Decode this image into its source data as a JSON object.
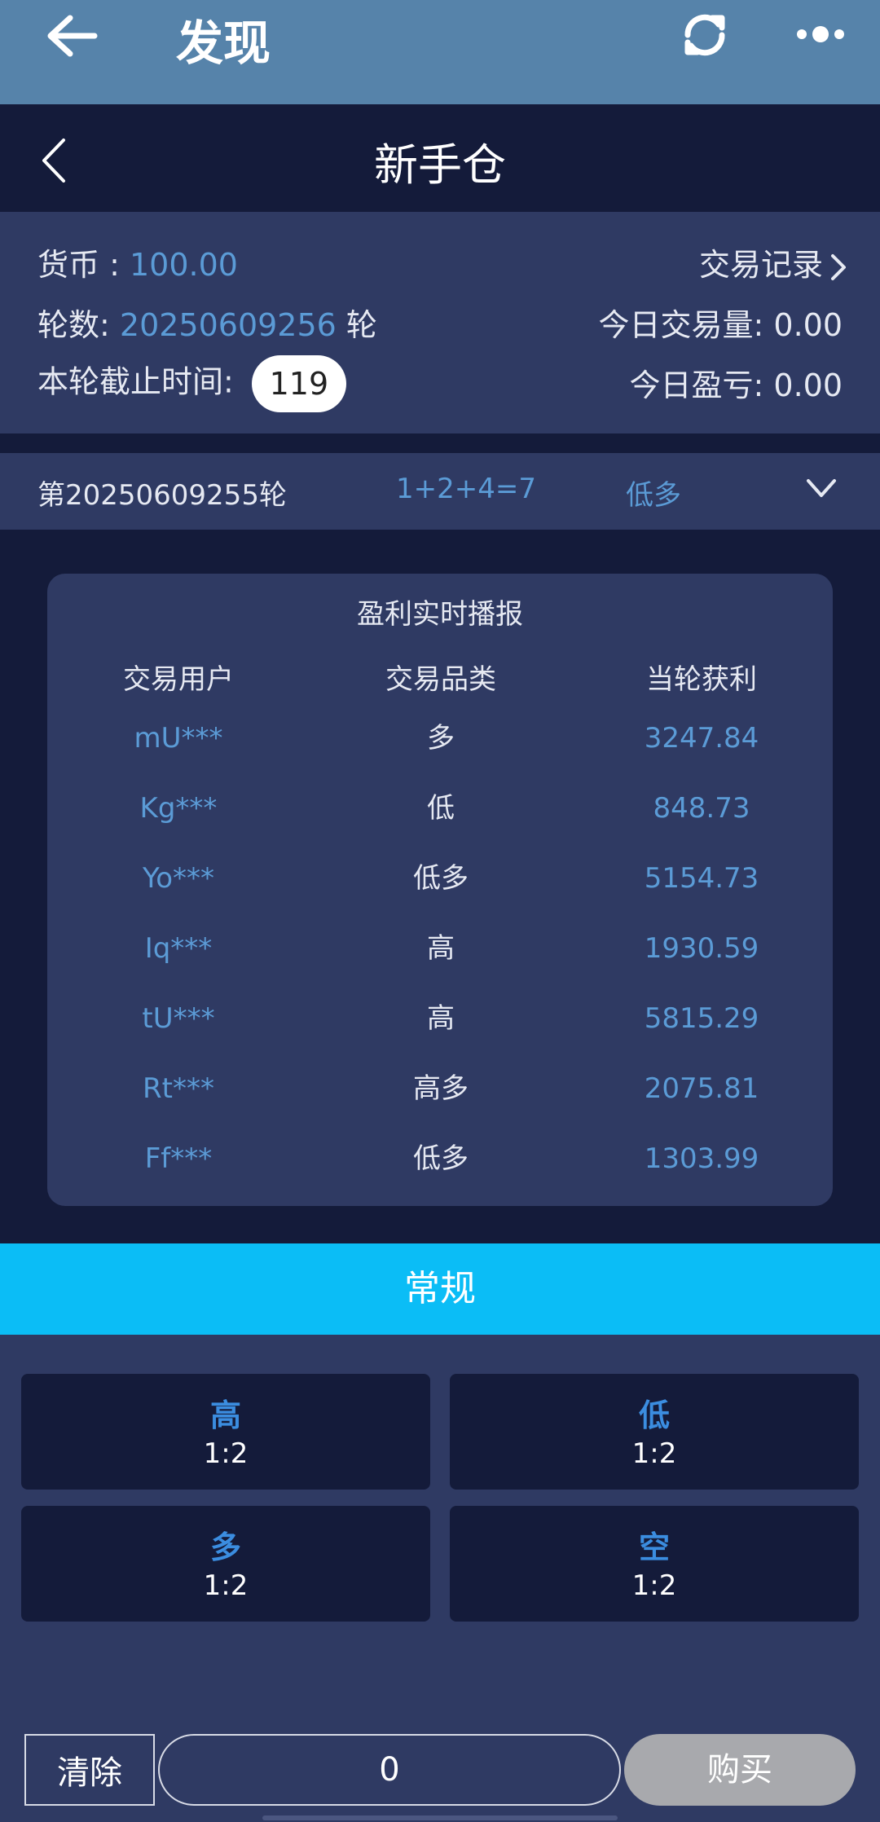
{
  "topbar": {
    "title": "发现"
  },
  "navbar": {
    "title": "新手仓"
  },
  "info": {
    "currency_label": "货币 : ",
    "currency_value": "100.00",
    "trade_record": "交易记录",
    "round_label": "轮数: ",
    "round_value": "20250609256",
    "round_unit": " 轮",
    "volume_label": "今日交易量: ",
    "volume_value": "0.00",
    "deadline_label": "本轮截止时间: ",
    "countdown": "119",
    "pnl_label": "今日盈亏: ",
    "pnl_value": "0.00"
  },
  "result": {
    "round": "第20250609255轮",
    "sum": "1+2+4=7",
    "outcome": "低多"
  },
  "broadcast": {
    "title": "盈利实时播报",
    "headers": [
      "交易用户",
      "交易品类",
      "当轮获利"
    ],
    "rows": [
      [
        "mU***",
        "多",
        "3247.84"
      ],
      [
        "Kg***",
        "低",
        "848.73"
      ],
      [
        "Yo***",
        "低多",
        "5154.73"
      ],
      [
        "Iq***",
        "高",
        "1930.59"
      ],
      [
        "tU***",
        "高",
        "5815.29"
      ],
      [
        "Rt***",
        "高多",
        "2075.81"
      ],
      [
        "Ff***",
        "低多",
        "1303.99"
      ]
    ]
  },
  "tab": {
    "label": "常规"
  },
  "options": [
    {
      "name": "高",
      "odds": "1:2"
    },
    {
      "name": "低",
      "odds": "1:2"
    },
    {
      "name": "多",
      "odds": "1:2"
    },
    {
      "name": "空",
      "odds": "1:2"
    }
  ],
  "bottom": {
    "clear": "清除",
    "amount": "0",
    "buy": "购买"
  }
}
